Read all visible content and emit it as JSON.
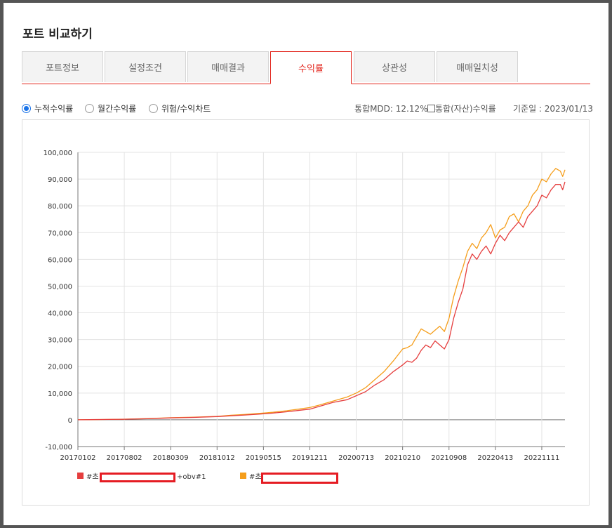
{
  "modal": {
    "title": "포트 비교하기"
  },
  "tabs": [
    {
      "label": "포트정보"
    },
    {
      "label": "설정조건"
    },
    {
      "label": "매매결과"
    },
    {
      "label": "수익률"
    },
    {
      "label": "상관성"
    },
    {
      "label": "매매일치성"
    }
  ],
  "options": {
    "radios": [
      {
        "label": "누적수익률",
        "selected": true
      },
      {
        "label": "월간수익률",
        "selected": false
      },
      {
        "label": "위험/수익차트",
        "selected": false
      }
    ],
    "mdd_text": "통합MDD: 12.12%",
    "integrated_checkbox_label": "통합(자산)수익률",
    "integrated_checked": false,
    "base_date": "기준일 : 2023/01/13"
  },
  "legend": [
    {
      "prefix": "#초",
      "suffix": "+obv#1",
      "color": "#e53e3e"
    },
    {
      "prefix": "#초",
      "suffix": "",
      "color": "#f59e1b"
    }
  ],
  "chart_data": {
    "type": "line",
    "y_ticks": [
      "-10,000",
      "0",
      "10,000",
      "20,000",
      "30,000",
      "40,000",
      "50,000",
      "60,000",
      "70,000",
      "80,000",
      "90,000",
      "100,000"
    ],
    "x_ticks": [
      "20170102",
      "20170802",
      "20180309",
      "20181012",
      "20190515",
      "20191211",
      "20200713",
      "20210210",
      "20210908",
      "20220413",
      "20221111"
    ],
    "ylim": [
      -10000,
      100000
    ],
    "grid": true,
    "series": [
      {
        "color": "#e53e3e",
        "x": [
          0,
          0.5,
          1,
          1.5,
          2,
          2.5,
          3,
          3.3,
          3.6,
          3.9,
          4.2,
          4.5,
          4.8,
          5,
          5.2,
          5.5,
          5.8,
          6,
          6.2,
          6.4,
          6.6,
          6.8,
          7,
          7.1,
          7.2,
          7.3,
          7.4,
          7.5,
          7.6,
          7.7,
          7.8,
          7.9,
          8,
          8.05,
          8.1,
          8.2,
          8.3,
          8.4,
          8.5,
          8.6,
          8.7,
          8.8,
          8.9,
          9,
          9.1,
          9.2,
          9.3,
          9.4,
          9.5,
          9.6,
          9.7,
          9.8,
          9.9,
          10,
          10.1,
          10.2,
          10.3,
          10.4,
          10.45,
          10.5
        ],
        "y": [
          0,
          100,
          200,
          400,
          700,
          900,
          1200,
          1500,
          1800,
          2100,
          2500,
          3000,
          3600,
          4000,
          5000,
          6500,
          7500,
          9000,
          10500,
          13000,
          15000,
          18000,
          20500,
          22000,
          21500,
          23000,
          26000,
          28000,
          27000,
          29500,
          28000,
          26500,
          30000,
          34000,
          38000,
          44000,
          49000,
          58000,
          62000,
          60000,
          63000,
          65000,
          62000,
          66000,
          69000,
          67000,
          70000,
          72000,
          74000,
          72000,
          76000,
          78000,
          80000,
          84000,
          83000,
          86000,
          88000,
          88000,
          86000,
          89000
        ]
      },
      {
        "color": "#f59e1b",
        "x": [
          0,
          0.5,
          1,
          1.5,
          2,
          2.5,
          3,
          3.3,
          3.6,
          3.9,
          4.2,
          4.5,
          4.8,
          5,
          5.2,
          5.5,
          5.8,
          6,
          6.2,
          6.4,
          6.6,
          6.8,
          7,
          7.1,
          7.2,
          7.3,
          7.4,
          7.5,
          7.6,
          7.7,
          7.8,
          7.9,
          8,
          8.05,
          8.1,
          8.2,
          8.3,
          8.4,
          8.5,
          8.6,
          8.7,
          8.8,
          8.9,
          9,
          9.1,
          9.2,
          9.3,
          9.4,
          9.5,
          9.6,
          9.7,
          9.8,
          9.9,
          10,
          10.1,
          10.2,
          10.3,
          10.4,
          10.45,
          10.5
        ],
        "y": [
          0,
          120,
          250,
          450,
          800,
          1000,
          1300,
          1700,
          2000,
          2400,
          2800,
          3400,
          4100,
          4600,
          5500,
          7000,
          8500,
          10000,
          12000,
          15000,
          18000,
          22000,
          26500,
          27000,
          28000,
          31000,
          34000,
          33000,
          32000,
          33500,
          35000,
          33000,
          38000,
          42000,
          46000,
          52000,
          57000,
          63000,
          66000,
          64000,
          68000,
          70000,
          73000,
          68000,
          71000,
          72000,
          76000,
          77000,
          74000,
          78000,
          80000,
          84000,
          86000,
          90000,
          89000,
          92000,
          94000,
          93000,
          91000,
          93500
        ]
      }
    ]
  }
}
